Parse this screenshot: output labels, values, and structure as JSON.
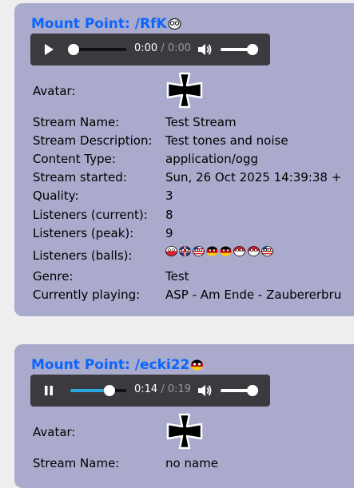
{
  "mounts": [
    {
      "title_prefix": "Mount Point: ",
      "mount": "/RfK",
      "ball_icon": "cyborg-face-ball-icon",
      "player": {
        "state": "paused",
        "current_time": "0:00",
        "separator": " / ",
        "duration": "0:00",
        "progress": 0,
        "volume": 0.9
      },
      "avatar_label": "Avatar:",
      "avatar_icon": "iron-cross-icon",
      "fields": [
        {
          "label": "Stream Name:",
          "value": "Test Stream"
        },
        {
          "label": "Stream Description:",
          "value": "Test tones and noise"
        },
        {
          "label": "Content Type:",
          "value": "application/ogg"
        },
        {
          "label": "Stream started:",
          "value": "Sun, 26 Oct 2025 14:39:38 +"
        },
        {
          "label": "Quality:",
          "value": "3"
        },
        {
          "label": "Listeners (current):",
          "value": "8"
        },
        {
          "label": "Listeners (peak):",
          "value": "9"
        }
      ],
      "balls_label": "Listeners (balls):",
      "listener_balls": [
        "red-white",
        "uk",
        "usa",
        "germany",
        "germany",
        "red-white",
        "red-white",
        "usa"
      ],
      "fields2": [
        {
          "label": "Genre:",
          "value": "Test"
        },
        {
          "label": "Currently playing:",
          "value": "ASP - Am Ende - Zaubererbru"
        }
      ]
    },
    {
      "title_prefix": "Mount Point: ",
      "mount": "/ecki22",
      "ball_icon": "germany-ball-icon",
      "player": {
        "state": "playing",
        "current_time": "0:14",
        "separator": " / ",
        "duration": "0:19",
        "progress": 0.7,
        "volume": 0.9
      },
      "avatar_label": "Avatar:",
      "avatar_icon": "iron-cross-icon",
      "fields": [
        {
          "label": "Stream Name:",
          "value": "no name"
        }
      ]
    }
  ]
}
